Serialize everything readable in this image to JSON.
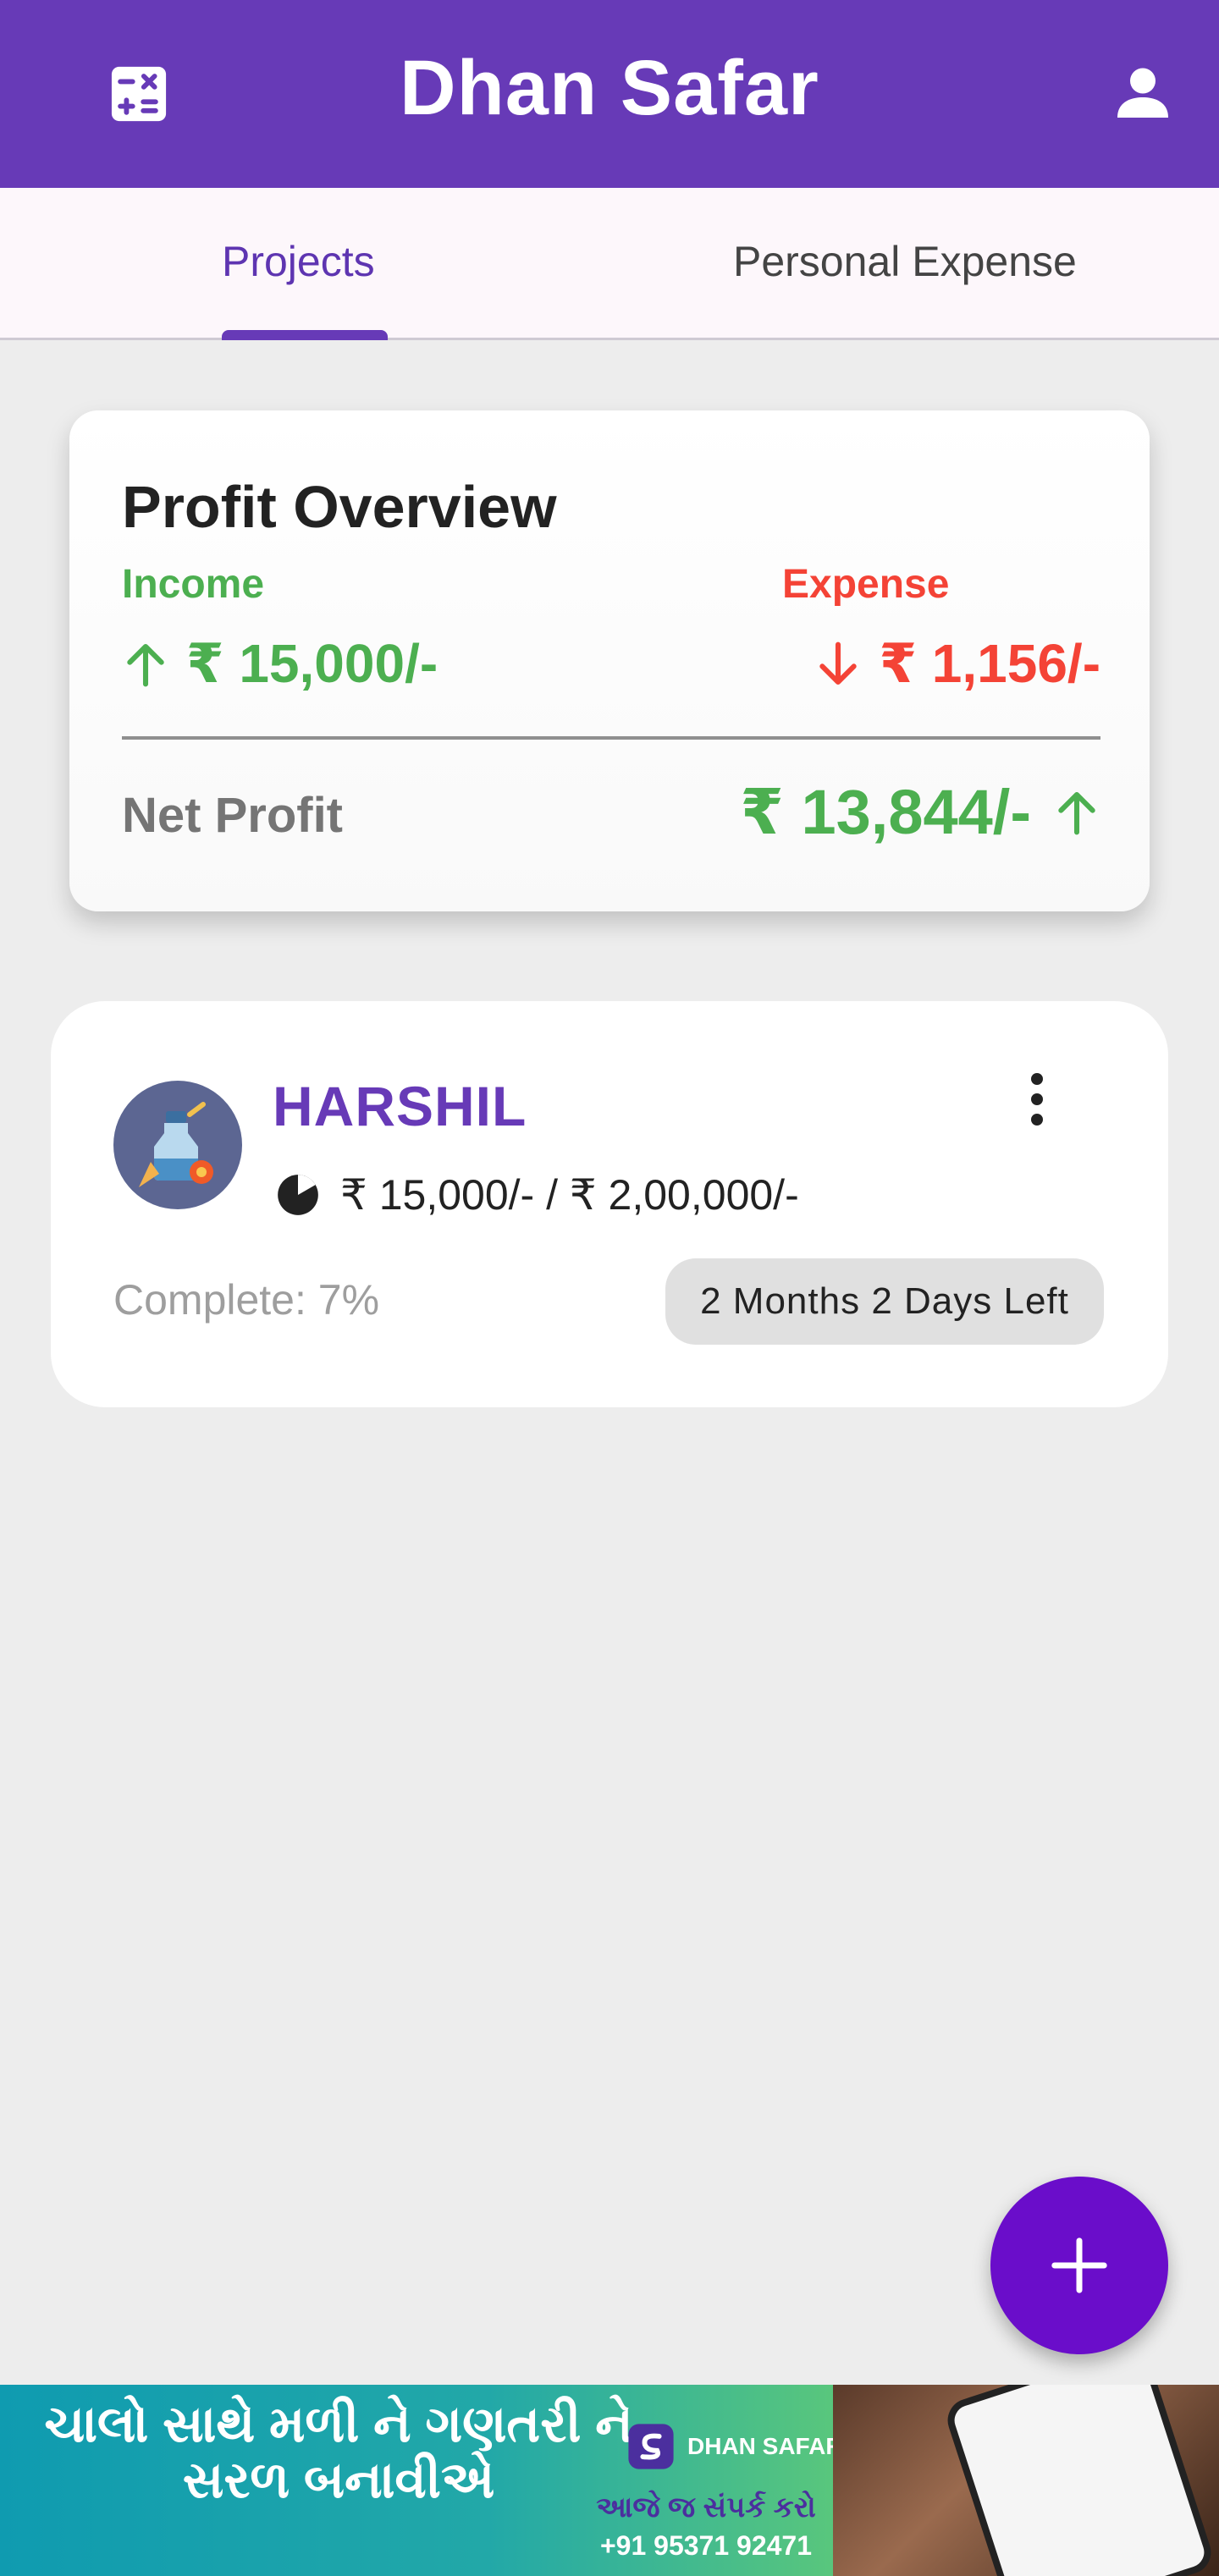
{
  "appbar": {
    "title": "Dhan Safar",
    "left_icon": "calculator-icon",
    "right_icon": "person-icon",
    "color": "#673ab7"
  },
  "tabs": [
    {
      "label": "Projects",
      "selected": true
    },
    {
      "label": "Personal Expense",
      "selected": false
    }
  ],
  "profit_overview": {
    "title": "Profit Overview",
    "income_label": "Income",
    "income_value": "₹ 15,000/-",
    "expense_label": "Expense",
    "expense_value": "₹ 1,156/-",
    "net_label": "Net Profit",
    "net_value": "₹ 13,844/-",
    "colors": {
      "income": "#4caf50",
      "expense": "#f44336"
    }
  },
  "projects": [
    {
      "name": "HARSHIL",
      "amount_text": "₹ 15,000/- /  ₹ 2,00,000/-",
      "complete_text": "Complete: 7%",
      "progress_fraction": 0.07,
      "time_left": "2 Months 2 Days Left",
      "avatar_icon": "bottle-icon",
      "menu_icon": "more-vertical-icon"
    }
  ],
  "fab": {
    "icon": "plus-icon",
    "color": "#6a0dca"
  },
  "ad": {
    "headline": "ચાલો સાથે મળી ને ગણતરી ને સરળ બનાવીએ",
    "brand": "DHAN SAFAR",
    "cta": "આજે જ સંપર્ક કરો",
    "phone": "+91 95371 92471"
  }
}
